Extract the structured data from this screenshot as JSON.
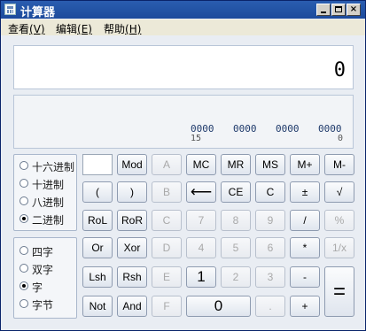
{
  "window": {
    "title": "计算器"
  },
  "titlebar_buttons": [
    "0",
    "1",
    "r"
  ],
  "menu": [
    {
      "label": "查看",
      "accel": "(V)"
    },
    {
      "label": "编辑",
      "accel": "(E)"
    },
    {
      "label": "帮助",
      "accel": "(H)"
    }
  ],
  "display": {
    "value": "0"
  },
  "bits": {
    "groups": [
      "0000",
      "0000",
      "0000",
      "0000"
    ],
    "left_index": "15",
    "right_index": "0"
  },
  "base_options": [
    {
      "label": "十六进制",
      "checked": false
    },
    {
      "label": "十进制",
      "checked": false
    },
    {
      "label": "八进制",
      "checked": false
    },
    {
      "label": "二进制",
      "checked": true
    }
  ],
  "word_options": [
    {
      "label": "四字",
      "checked": false
    },
    {
      "label": "双字",
      "checked": false
    },
    {
      "label": "字",
      "checked": true
    },
    {
      "label": "字节",
      "checked": false
    }
  ],
  "keys": {
    "mod": "Mod",
    "a": "A",
    "mc": "MC",
    "mr": "MR",
    "ms": "MS",
    "mplus": "M+",
    "mminus": "M-",
    "lparen": "(",
    "rparen": ")",
    "b": "B",
    "back": "⟵",
    "ce": "CE",
    "c": "C",
    "pm": "±",
    "sqrt": "√",
    "rol": "RoL",
    "ror": "RoR",
    "cc": "C",
    "k7": "7",
    "k8": "8",
    "k9": "9",
    "div": "/",
    "pct": "%",
    "or": "Or",
    "xor": "Xor",
    "d": "D",
    "k4": "4",
    "k5": "5",
    "k6": "6",
    "mul": "*",
    "inv": "1/x",
    "lsh": "Lsh",
    "rsh": "Rsh",
    "e": "E",
    "k1": "1",
    "k2": "2",
    "k3": "3",
    "sub": "-",
    "eq": "=",
    "not": "Not",
    "and": "And",
    "f": "F",
    "k0": "0",
    "dot": ".",
    "add": "+"
  }
}
